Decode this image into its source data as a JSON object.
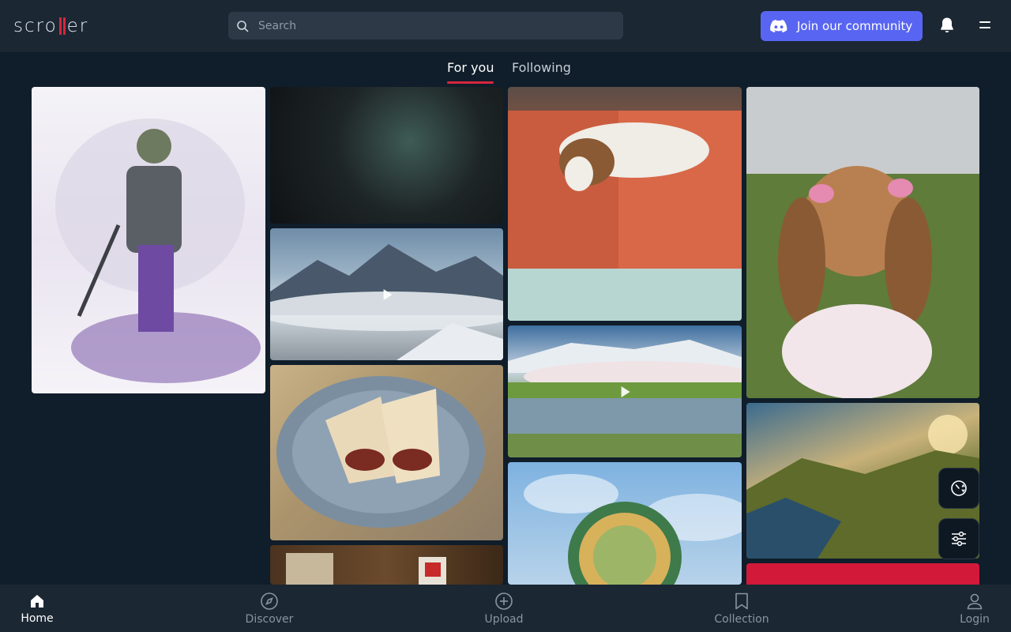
{
  "brand": {
    "logo_left": "scro",
    "logo_right": "er",
    "accent": "#d7263d"
  },
  "header": {
    "search_placeholder": "Search",
    "join_label": "Join our community",
    "join_color": "#5865f2"
  },
  "tabs": [
    {
      "label": "For you",
      "active": true
    },
    {
      "label": "Following",
      "active": false
    }
  ],
  "tiles": [
    {
      "name": "tile-gnome-wizard-art",
      "video": false
    },
    {
      "name": "tile-dark-fantasy-art",
      "video": false
    },
    {
      "name": "tile-mountain-clouds",
      "video": true
    },
    {
      "name": "tile-burrito-plate",
      "video": false
    },
    {
      "name": "tile-book-shelf",
      "video": false
    },
    {
      "name": "tile-basset-on-quilt",
      "video": false
    },
    {
      "name": "tile-cherry-blossom-river",
      "video": true
    },
    {
      "name": "tile-jellyfish-sky",
      "video": false
    },
    {
      "name": "tile-basset-in-dress",
      "video": false
    },
    {
      "name": "tile-coastal-cliffs",
      "video": false
    },
    {
      "name": "tile-red-banner",
      "video": false
    }
  ],
  "floating": {
    "history_icon": "history-icon",
    "filter_icon": "filter-sliders-icon"
  },
  "bottom_nav": [
    {
      "label": "Home",
      "icon": "home-icon",
      "active": true
    },
    {
      "label": "Discover",
      "icon": "compass-icon",
      "active": false
    },
    {
      "label": "Upload",
      "icon": "plus-circle-icon",
      "active": false
    },
    {
      "label": "Collection",
      "icon": "bookmark-icon",
      "active": false
    },
    {
      "label": "Login",
      "icon": "user-icon",
      "active": false
    }
  ]
}
